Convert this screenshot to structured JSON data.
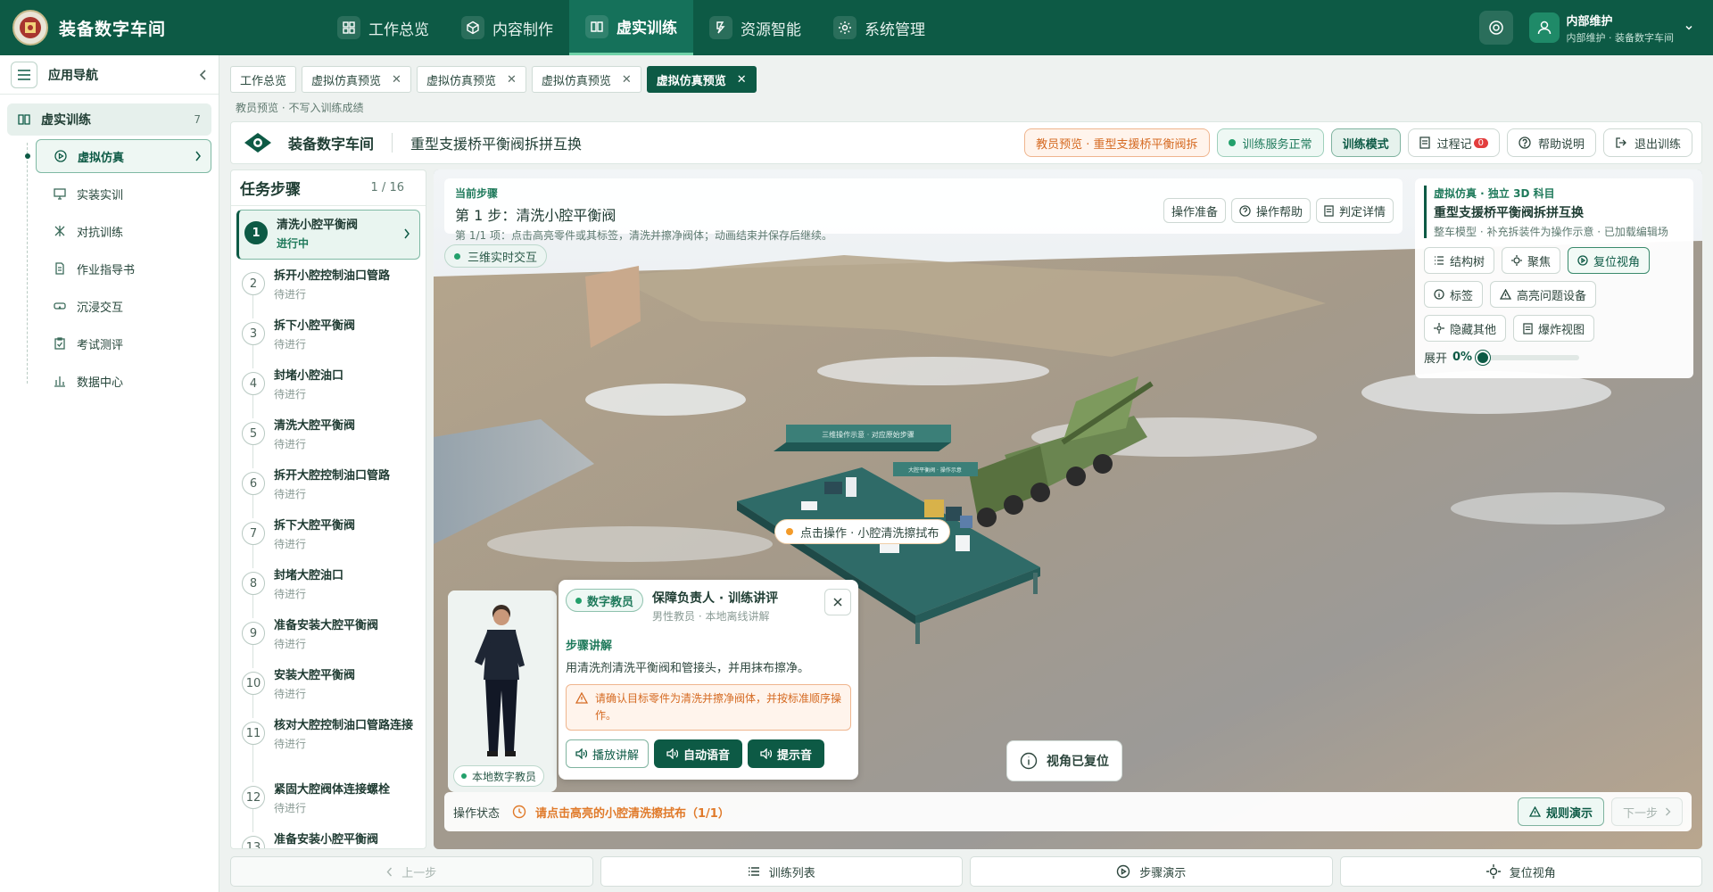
{
  "app": {
    "title": "装备数字车间"
  },
  "topnav": [
    {
      "label": "工作总览",
      "icon": "grid-icon"
    },
    {
      "label": "内容制作",
      "icon": "cube-icon"
    },
    {
      "label": "虚实训练",
      "icon": "book-icon",
      "active": true
    },
    {
      "label": "资源智能",
      "icon": "ai-icon"
    },
    {
      "label": "系统管理",
      "icon": "gear-icon"
    }
  ],
  "user": {
    "name": "内部维护",
    "subtitle": "内部维护 · 装备数字车间"
  },
  "sidebar": {
    "title": "应用导航",
    "group": {
      "label": "虚实训练",
      "count": "7"
    },
    "items": [
      {
        "label": "虚拟仿真",
        "icon": "play-circle-icon",
        "active": true
      },
      {
        "label": "实装实训",
        "icon": "monitor-icon"
      },
      {
        "label": "对抗训练",
        "icon": "swords-icon"
      },
      {
        "label": "作业指导书",
        "icon": "document-icon"
      },
      {
        "label": "沉浸交互",
        "icon": "vr-headset-icon"
      },
      {
        "label": "考试测评",
        "icon": "clipboard-icon"
      },
      {
        "label": "数据中心",
        "icon": "bar-chart-icon"
      }
    ]
  },
  "tabs": [
    {
      "label": "工作总览",
      "closable": false
    },
    {
      "label": "虚拟仿真预览",
      "closable": true
    },
    {
      "label": "虚拟仿真预览",
      "closable": true
    },
    {
      "label": "虚拟仿真预览",
      "closable": true
    },
    {
      "label": "虚拟仿真预览",
      "closable": true,
      "active": true
    }
  ],
  "note": "教员预览 · 不写入训练成绩",
  "scene": {
    "brand": "装备数字车间",
    "title": "重型支援桥平衡阀拆拼互换",
    "preview_pill": "教员预览 · 重型支援桥平衡阀拆",
    "service_pill": "训练服务正常",
    "mode_pill": "训练模式",
    "record_label": "过程记",
    "record_badge": "0",
    "help_label": "帮助说明",
    "exit_label": "退出训练"
  },
  "steps": {
    "title": "任务步骤",
    "count": "1 / 16",
    "items": [
      {
        "num": "1",
        "name": "清洗小腔平衡阀",
        "status": "进行中",
        "active": true
      },
      {
        "num": "2",
        "name": "拆开小腔控制油口管路",
        "status": "待进行"
      },
      {
        "num": "3",
        "name": "拆下小腔平衡阀",
        "status": "待进行"
      },
      {
        "num": "4",
        "name": "封堵小腔油口",
        "status": "待进行"
      },
      {
        "num": "5",
        "name": "清洗大腔平衡阀",
        "status": "待进行"
      },
      {
        "num": "6",
        "name": "拆开大腔控制油口管路",
        "status": "待进行"
      },
      {
        "num": "7",
        "name": "拆下大腔平衡阀",
        "status": "待进行"
      },
      {
        "num": "8",
        "name": "封堵大腔油口",
        "status": "待进行"
      },
      {
        "num": "9",
        "name": "准备安装大腔平衡阀",
        "status": "待进行"
      },
      {
        "num": "10",
        "name": "安装大腔平衡阀",
        "status": "待进行"
      },
      {
        "num": "11",
        "name": "核对大腔控制油口管路连接",
        "status": "待进行"
      },
      {
        "num": "12",
        "name": "紧固大腔阀体连接螺栓",
        "status": "待进行"
      },
      {
        "num": "13",
        "name": "准备安装小腔平衡阀",
        "status": ""
      }
    ]
  },
  "current": {
    "label": "当前步骤",
    "title": "第 1 步：清洗小腔平衡阀",
    "desc": "第 1/1 项：点击高亮零件或其标签，清洗并擦净阀体；动画结束并保存后继续。",
    "btn_prepare": "操作准备",
    "btn_help": "操作帮助",
    "btn_judge": "判定详情"
  },
  "live_badge": "三维实时交互",
  "tools": {
    "sub": "虚拟仿真 · 独立 3D 科目",
    "title": "重型支援桥平衡阀拆拼互换",
    "desc": "整车模型 · 补充拆装件为操作示意 · 已加载编辑场",
    "btn_tree": "结构树",
    "btn_focus": "聚焦",
    "btn_reset_view": "复位视角",
    "btn_label": "标签",
    "btn_highlight": "高亮问题设备",
    "btn_hide": "隐藏其他",
    "btn_explode": "爆炸视图",
    "expand_label": "展开",
    "expand_value": "0%",
    "expand_fraction": 0
  },
  "hotspot": "点击操作 · 小腔清洗擦拭布",
  "scene3d": {
    "panel_main": "三维操作示意 · 对应原始步骤",
    "panel_small": "大腔平衡阀 · 操作示意",
    "colors": {
      "bench": "#2f6b68",
      "truck": "#5d7a45",
      "panel": "#3b7f78"
    }
  },
  "avatar": {
    "label": "本地数字教员"
  },
  "dialog": {
    "tag": "数字教员",
    "name": "保障负责人 · 训练讲评",
    "sub": "男性教员 · 本地离线讲解",
    "section": "步骤讲解",
    "text": "用清洗剂清洗平衡阀和管接头，并用抹布擦净。",
    "warn": "请确认目标零件为清洗并擦净阀体，并按标准顺序操作。",
    "btn_play": "播放讲解",
    "btn_auto": "自动语音",
    "btn_tone": "提示音"
  },
  "reset_toast": "视角已复位",
  "opbar": {
    "label": "操作状态",
    "msg": "请点击高亮的小腔清洗擦拭布（1/1）",
    "btn_rule": "规则演示",
    "btn_next": "下一步"
  },
  "bottom": {
    "prev": "上一步",
    "list": "训练列表",
    "demo": "步骤演示",
    "reset": "复位视角"
  },
  "colors": {
    "primary": "#0d5a45",
    "accent": "#1f7a5b",
    "warn": "#d56a22",
    "ok": "#22a06b"
  }
}
